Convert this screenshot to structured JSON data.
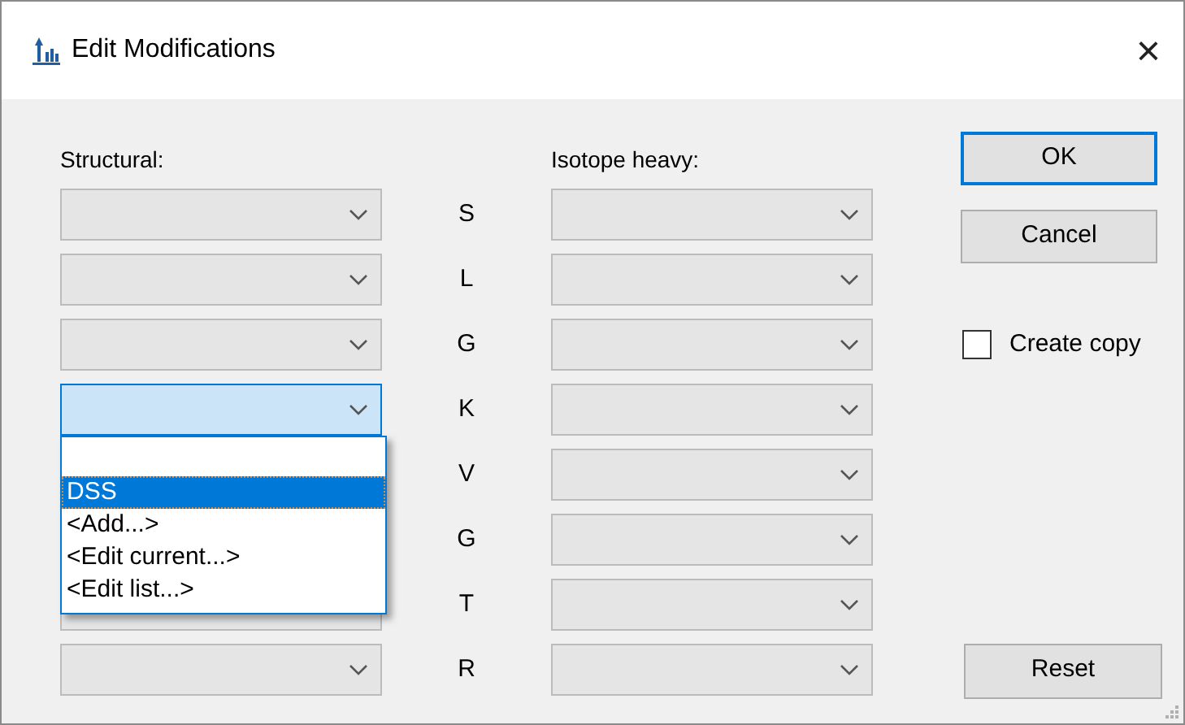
{
  "window": {
    "title": "Edit Modifications",
    "close": "×"
  },
  "structural_label": "Structural:",
  "isotope_label": "Isotope heavy:",
  "rows": [
    {
      "residue": "S",
      "expanded": false
    },
    {
      "residue": "L",
      "expanded": false
    },
    {
      "residue": "G",
      "expanded": false
    },
    {
      "residue": "K",
      "expanded": true
    },
    {
      "residue": "V",
      "expanded": false
    },
    {
      "residue": "G",
      "expanded": false
    },
    {
      "residue": "T",
      "expanded": false
    },
    {
      "residue": "R",
      "expanded": false
    }
  ],
  "dropdown": {
    "items": [
      {
        "label": "DSS",
        "selected": true
      },
      {
        "label": "<Add...>",
        "selected": false
      },
      {
        "label": "<Edit current...>",
        "selected": false
      },
      {
        "label": "<Edit list...>",
        "selected": false
      }
    ]
  },
  "buttons": {
    "ok": "OK",
    "cancel": "Cancel",
    "reset": "Reset"
  },
  "create_copy": {
    "label": "Create copy",
    "checked": false
  }
}
